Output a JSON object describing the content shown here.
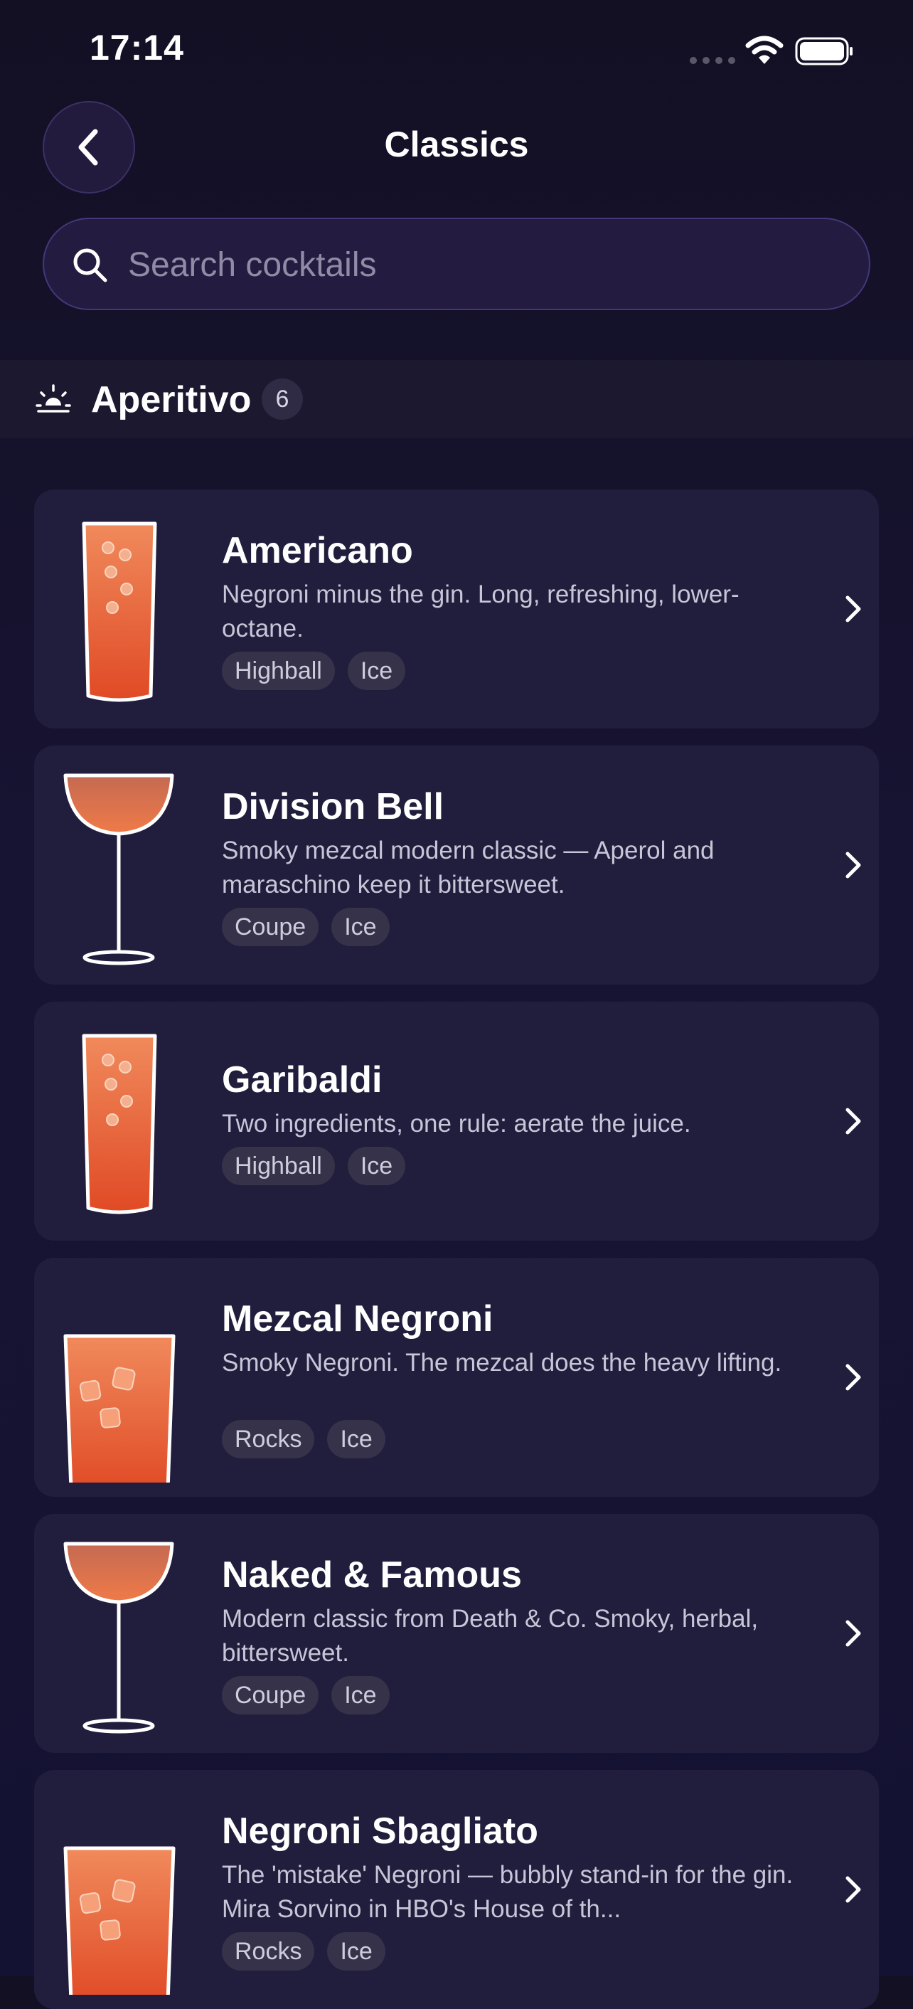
{
  "status_bar": {
    "time": "17:14"
  },
  "header": {
    "title": "Classics"
  },
  "search": {
    "placeholder": "Search cocktails",
    "value": ""
  },
  "section": {
    "icon": "sunrise-icon",
    "title": "Aperitivo",
    "count": "6"
  },
  "drinks": [
    {
      "name": "Americano",
      "description": "Negroni minus the gin. Long, refreshing, lower-octane.",
      "glass": "highball",
      "tags": [
        "Highball",
        "Ice"
      ]
    },
    {
      "name": "Division Bell",
      "description": "Smoky mezcal modern classic — Aperol and maraschino keep it bittersweet.",
      "glass": "coupe",
      "tags": [
        "Coupe",
        "Ice"
      ]
    },
    {
      "name": "Garibaldi",
      "description": "Two ingredients, one rule: aerate the juice.",
      "glass": "highball",
      "tags": [
        "Highball",
        "Ice"
      ]
    },
    {
      "name": "Mezcal Negroni",
      "description": "Smoky Negroni. The mezcal does the heavy lifting.",
      "glass": "rocks",
      "tags": [
        "Rocks",
        "Ice"
      ]
    },
    {
      "name": "Naked & Famous",
      "description": "Modern classic from Death & Co. Smoky, herbal, bittersweet.",
      "glass": "coupe",
      "tags": [
        "Coupe",
        "Ice"
      ]
    },
    {
      "name": "Negroni Sbagliato",
      "description": "The 'mistake' Negroni — bubbly stand-in for the gin. Mira Sorvino in HBO's House of th...",
      "glass": "rocks",
      "tags": [
        "Rocks",
        "Ice"
      ]
    }
  ],
  "colors": {
    "background": "#141232",
    "card": "#211d3c",
    "accent_border": "#44387a",
    "drink_orange": "#ee6a3c"
  }
}
